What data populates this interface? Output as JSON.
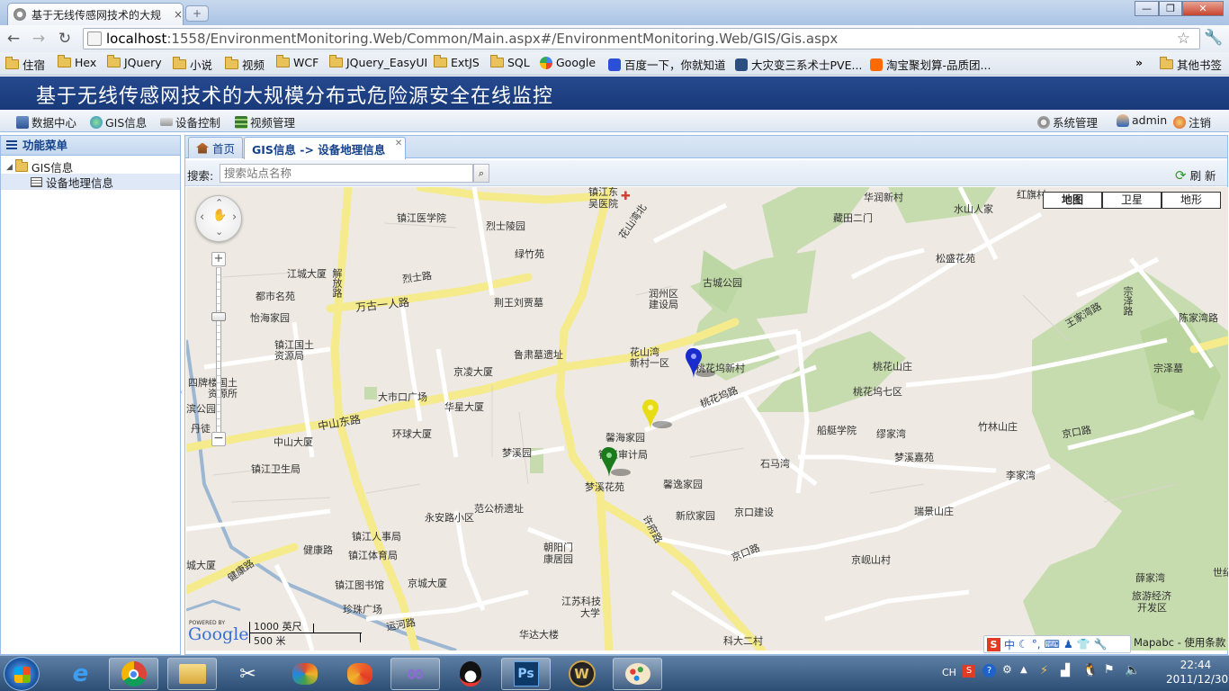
{
  "browser": {
    "tab_title": "基于无线传感网技术的大规",
    "tab_close": "×",
    "new_tab": "+",
    "url_host": "localhost",
    "url_path": ":1558/EnvironmentMonitoring.Web/Common/Main.aspx#/EnvironmentMonitoring.Web/GIS/Gis.aspx",
    "window_min": "—",
    "window_max": "❐",
    "window_close": "✕",
    "bookmarks": [
      "住宿",
      "Hex",
      "JQuery",
      "小说",
      "视频",
      "WCF",
      "JQuery_EasyUI",
      "ExtJS",
      "SQL",
      "Google",
      "百度一下，你就知道",
      "大灾变三系术士PVE...",
      "淘宝聚划算-品质团..."
    ],
    "bookmarks_more": "»",
    "other_bookmarks": "其他书签"
  },
  "app": {
    "title": "基于无线传感网技术的大规模分布式危险源安全在线监控",
    "menu": [
      "数据中心",
      "GIS信息",
      "设备控制",
      "视频管理"
    ],
    "system_admin": "系统管理",
    "user": "admin",
    "logout": "注销"
  },
  "sidebar": {
    "header": "功能菜单",
    "tree": [
      {
        "label": "GIS信息"
      },
      {
        "label": "设备地理信息"
      }
    ]
  },
  "tabs": [
    {
      "label": "首页"
    },
    {
      "label": "GIS信息 -> 设备地理信息"
    }
  ],
  "search": {
    "label": "搜索:",
    "placeholder": "搜索站点名称",
    "refresh": "刷 新"
  },
  "map": {
    "types": [
      "地图",
      "卫星",
      "地形"
    ],
    "scale_imperial": "1000 英尺",
    "scale_metric": "500 米",
    "powered_by": "POWERED BY",
    "google": "Google",
    "attribution": "Mapabc - 使用条款",
    "labels": {
      "l1": "镇江东",
      "l2": "吴医院",
      "l3": "华润新村",
      "l4": "水山人家",
      "l5": "红旗村",
      "l6": "镇江医学院",
      "l7": "烈士陵园",
      "l8": "藏田二门",
      "l9": "绿竹苑",
      "l10": "花山湾北",
      "l11": "古城公园",
      "l12": "松盛花苑",
      "l13": "江城大厦",
      "l14": "烈士路",
      "l15": "都市名苑",
      "l16": "万古一人路",
      "l17": "荆王刘贾墓",
      "l18": "润州区",
      "l19": "建设局",
      "l20": "王家湾路",
      "l21": "陈家湾路",
      "l22": "怡海家园",
      "l23": "镇江国土",
      "l24": "资源局",
      "l25": "鲁肃墓遗址",
      "l26": "花山湾",
      "l27": "新村一区",
      "l28": "桃花坞新村",
      "l29": "宗泽墓",
      "l30": "京凌大厦",
      "l31": "桃花山庄",
      "l32": "四牌楼国土",
      "l33": "资源所",
      "l34": "大市口广场",
      "l35": "桃花坞七区",
      "l36": "桃花坞路",
      "l37": "华星大厦",
      "l38": "滨公园",
      "l39": "中山东路",
      "l40": "船艇学院",
      "l41": "缪家湾",
      "l42": "竹林山庄",
      "l43": "丹徒",
      "l44": "环球大厦",
      "l45": "馨海家园",
      "l46": "京口路",
      "l47": "中山大厦",
      "l48": "梦溪园",
      "l49": "镇江审计局",
      "l50": "梦溪嘉苑",
      "l51": "镇江卫生局",
      "l52": "石马湾",
      "l53": "李家湾",
      "l54": "梦溪花苑",
      "l55": "馨逸家园",
      "l56": "范公桥遗址",
      "l57": "京口建设",
      "l58": "瑞景山庄",
      "l59": "永安路小区",
      "l60": "新欣家园",
      "l61": "镇江人事局",
      "l62": "健康路",
      "l63": "镇江体育局",
      "l64": "朝阳门",
      "l65": "康居园",
      "l66": "京口路",
      "l67": "京岘山村",
      "l68": "镇江图书馆",
      "l69": "京城大厦",
      "l70": "薛家湾",
      "l71": "珍珠广场",
      "l72": "江苏科技",
      "l73": "大学",
      "l74": "旅游经济",
      "l75": "开发区",
      "l76": "华达大楼",
      "l77": "科大二村",
      "l78": "解放路",
      "l79": "宗泽路",
      "l80": "许府路",
      "l81": "健康路",
      "l82": "运河路",
      "l83": "城大厦",
      "l84": "世纪"
    }
  },
  "markers": [
    {
      "name": "blue-station",
      "color": "#1a2ccc"
    },
    {
      "name": "yellow-station",
      "color": "#e8dc16"
    },
    {
      "name": "green-station",
      "color": "#1b7a1b"
    }
  ],
  "taskbar": {
    "time": "22:44",
    "date": "2011/12/30",
    "lang": "CH"
  }
}
